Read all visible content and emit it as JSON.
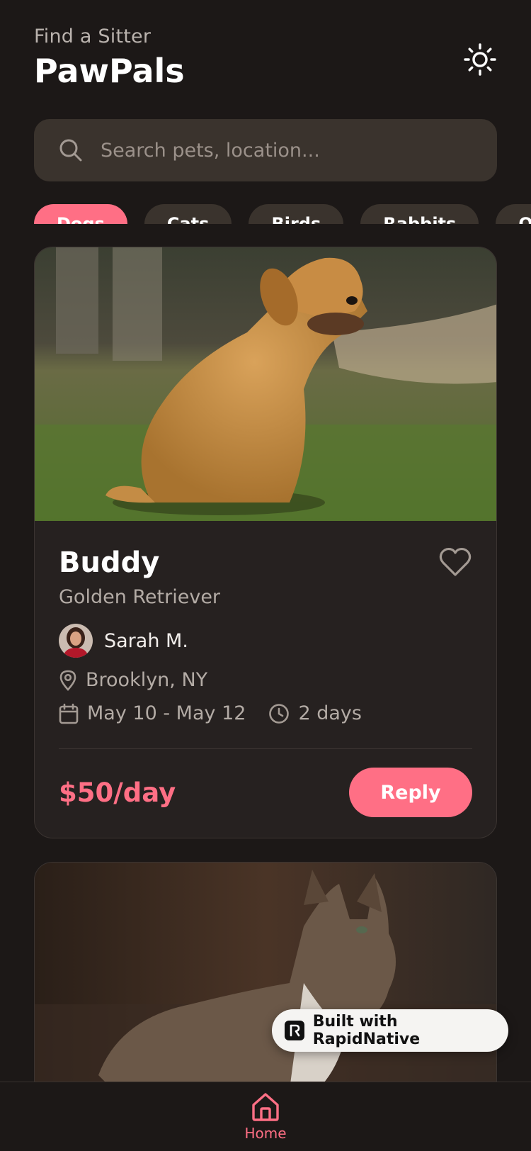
{
  "header": {
    "subtitle": "Find a Sitter",
    "title": "PawPals",
    "theme_toggle_icon": "sun-icon"
  },
  "search": {
    "placeholder": "Search pets, location...",
    "value": ""
  },
  "filters": {
    "chips": [
      "Dogs",
      "Cats",
      "Birds",
      "Rabbits",
      "Other"
    ],
    "active_index": 0
  },
  "listings": [
    {
      "name": "Buddy",
      "breed": "Golden Retriever",
      "owner": "Sarah M.",
      "location": "Brooklyn, NY",
      "dates": "May 10 - May 12",
      "duration": "2 days",
      "price": "$50/day",
      "action": "Reply",
      "favorite": false
    },
    {
      "image_subject": "cat"
    }
  ],
  "badge": {
    "text": "Built with RapidNative"
  },
  "tabbar": {
    "home_label": "Home"
  },
  "colors": {
    "accent": "#ff6f85",
    "background": "#1c1817",
    "card": "#262120",
    "input": "#3a332d"
  }
}
